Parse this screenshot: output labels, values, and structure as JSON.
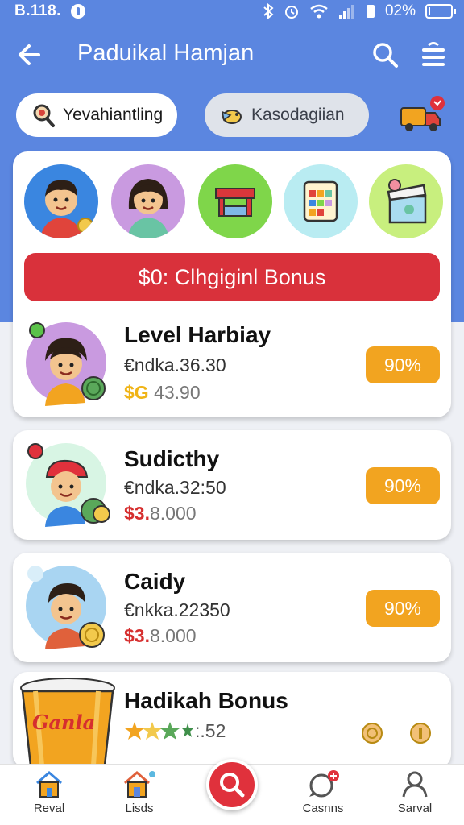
{
  "status_bar": {
    "time": "B.118.",
    "battery_pct": "02%"
  },
  "app_bar": {
    "title": "Paduikal Hamjan"
  },
  "chips": [
    {
      "label": "Yevahiantling"
    },
    {
      "label": "Kasodagiian"
    }
  ],
  "bonus_banner": {
    "label": "$0: Clhgiginl Bonus"
  },
  "items": [
    {
      "title": "Level Harbiay",
      "subtitle": "€ndka.36.30",
      "currency": "$G",
      "value": "43.90",
      "badge": "90%"
    },
    {
      "title": "Sudicthy",
      "subtitle": "€ndka.32:50",
      "currency": "$3.",
      "value": "8.000",
      "badge": "90%"
    },
    {
      "title": "Caidy",
      "subtitle": "€nkka.22350",
      "currency": "$3.",
      "value": "8.000",
      "badge": "90%"
    },
    {
      "title": "Hadikah Bonus",
      "subtitle": ":.52",
      "cup_text": "Ganla"
    }
  ],
  "bottom_nav": [
    {
      "label": "Reval"
    },
    {
      "label": "Lisds"
    },
    {
      "label": "Casnns"
    },
    {
      "label": "Sarval"
    }
  ],
  "colors": {
    "header": "#5b86e0",
    "accent_red": "#d9313b",
    "badge_orange": "#f2a420"
  }
}
